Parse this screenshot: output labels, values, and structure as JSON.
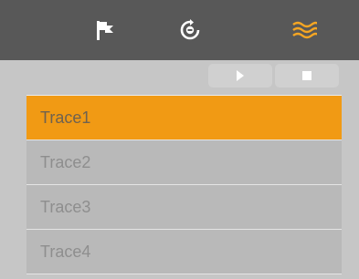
{
  "toolbar": {
    "icons": [
      {
        "name": "flag-icon",
        "active": false
      },
      {
        "name": "sync-icon",
        "active": false
      },
      {
        "name": "waves-icon",
        "active": true
      }
    ],
    "icon_color": "#ffffff",
    "active_color": "#f5a623",
    "background": "#585858"
  },
  "controls": {
    "play_icon": "play-icon",
    "stop_icon": "stop-icon"
  },
  "traces": {
    "items": [
      {
        "label": "Trace1",
        "selected": true
      },
      {
        "label": "Trace2",
        "selected": false
      },
      {
        "label": "Trace3",
        "selected": false
      },
      {
        "label": "Trace4",
        "selected": false
      }
    ],
    "selected_color": "#f19a14"
  }
}
